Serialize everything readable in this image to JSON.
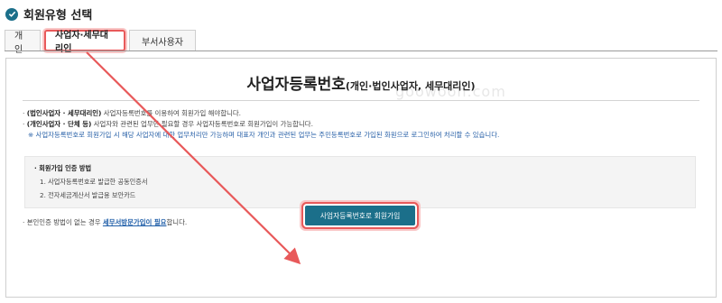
{
  "header": {
    "title": "회원유형 선택",
    "icon": "check-circle-icon",
    "accent": "#1b6f8a"
  },
  "tabs": [
    {
      "label": "개인"
    },
    {
      "label": "사업자·세무대리인",
      "selected": true
    },
    {
      "label": "부서사용자"
    }
  ],
  "panel": {
    "title_main": "사업자등록번호",
    "title_sub": "(개인·법인사업자, 세무대리인)",
    "lines": [
      {
        "bullet": "·",
        "bold": "(법인사업자 · 세무대리인)",
        "text": " 사업자등록번호를 이용하여 회원가입 해야합니다."
      },
      {
        "bullet": "·",
        "bold": "(개인사업자 · 단체 등)",
        "text": " 사업자와 관련된 업무만 필요할 경우 사업자등록번호로 회원가입이 가능합니다."
      }
    ],
    "note": "※ 사업자등록번호로 회원가입 시 해당 사업자에 대한 업무처리만 가능하며 대표자 개인과 관련된 업무는 주민등록번호로 가입된 화원으로 로그인하여 처리할 수 있습니다.",
    "auth": {
      "title": "· 회원가입 인증 방법",
      "items": [
        "1. 사업자등록번호로 발급한 공동인증서",
        "2. 전자세금계산서 발급용 보안카드"
      ]
    },
    "bottom_prefix": "· 본인인증 방법이 없는 경우 ",
    "bottom_link": "세무서방문가입이 필요",
    "bottom_suffix": "합니다.",
    "watermark": "goowoon.com",
    "signup_button": "사업자등록번호로 회원가입"
  },
  "colors": {
    "highlight": "#e8595a",
    "button": "#1b6f8a",
    "link": "#1f5ea8"
  }
}
